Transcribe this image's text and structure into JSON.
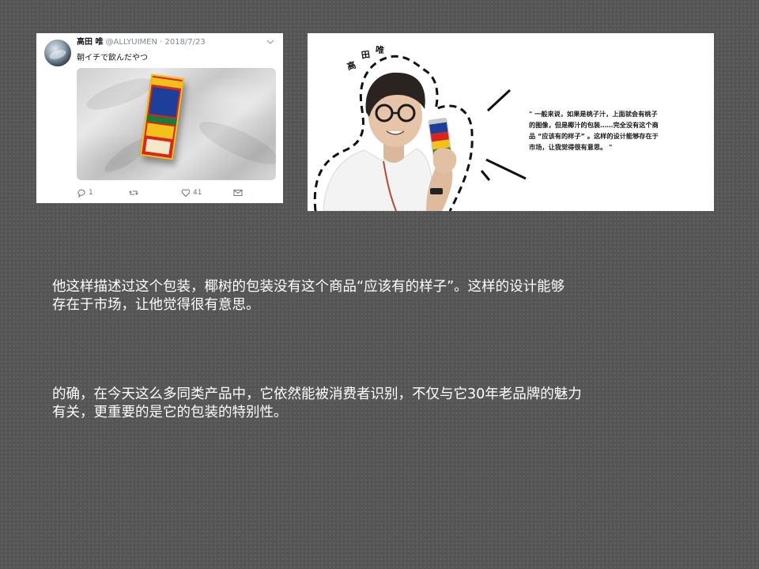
{
  "tweet": {
    "author_name": "高田 唯",
    "handle_date": "@ALLYUIMEN · 2018/7/23",
    "text": "朝イチで飲んだやつ",
    "actions": {
      "reply_count": "1",
      "retweet_count": "",
      "like_count": "41"
    },
    "icons": [
      "reply-icon",
      "retweet-icon",
      "heart-icon",
      "message-icon",
      "chevron-down-icon"
    ]
  },
  "panel": {
    "name_chars": [
      "高",
      "田",
      "唯"
    ],
    "quote_lines": [
      "\" 一般来说，如果是桃子汁，上面就会有桃子",
      "的图像，但是椰汁的包装……完全没有这个商",
      "品 “应该有的样子” 。这样的设计能够存在于",
      "市场，让我觉得很有意思。 \""
    ]
  },
  "body": {
    "paragraph1_line1": "他这样描述过这个包装，椰树的包装没有这个商品“应该有的样子”。这样的设计能够",
    "paragraph1_line2": "存在于市场，让他觉得很有意思。",
    "paragraph2_line1": "的确，在今天这么多同类产品中，它依然能被消费者识别，不仅与它30年老品牌的魅力",
    "paragraph2_line2": "有关，更重要的是它的包装的特别性。"
  },
  "colors": {
    "background": "#555555",
    "text_light": "#ffffff",
    "can_red": "#d9261c",
    "can_yellow": "#f2c21b",
    "can_blue": "#1c3f9a"
  }
}
